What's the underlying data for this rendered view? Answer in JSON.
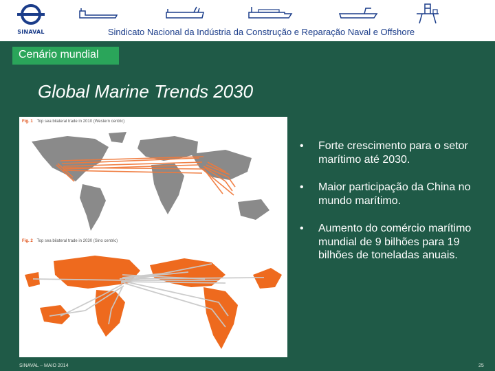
{
  "header": {
    "logo_text": "SINAVAL",
    "title": "Sindicato Nacional da Indústria da Construção e Reparação Naval e Offshore",
    "icons": [
      "tanker-ship-icon",
      "bulk-carrier-icon",
      "container-ship-icon",
      "supply-vessel-icon",
      "oil-platform-icon"
    ]
  },
  "section_label": "Cenário mundial",
  "slide_title": "Global Marine Trends 2030",
  "figure": {
    "fig1": {
      "num": "Fig. 1",
      "caption": "Top sea bilateral trade in 2010 (Western centric)"
    },
    "fig2": {
      "num": "Fig. 2",
      "caption": "Top sea bilateral trade in 2030 (Sino centric)"
    },
    "colors": {
      "map_2010": "#8a8a8a",
      "routes_2010": "#f07a3c",
      "map_2030": "#ee6a1e",
      "routes_2030": "#c9c9c9"
    }
  },
  "bullets": [
    {
      "text": "Forte crescimento para o setor marítimo até 2030."
    },
    {
      "text": "Maior participação da China no mundo marítimo."
    },
    {
      "text": "Aumento do comércio marítimo mundial de 9 bilhões para 19 bilhões de toneladas anuais."
    }
  ],
  "bullet_glyph": "•",
  "footer": {
    "left": "SINAVAL – MAIO 2014",
    "page": "25"
  },
  "colors": {
    "background": "#1f5a47",
    "accent_green": "#2aa55a",
    "brand_blue": "#1b3d8a"
  }
}
